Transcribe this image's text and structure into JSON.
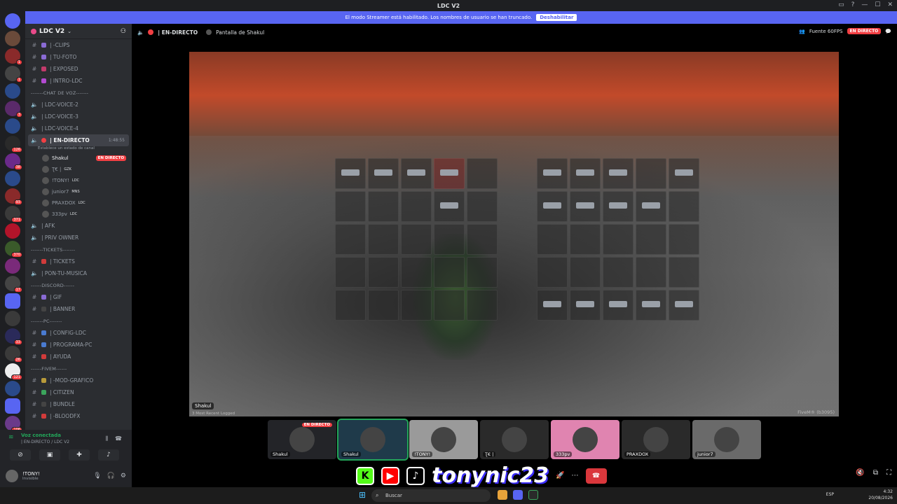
{
  "window": {
    "title": "LDC V2"
  },
  "banner": {
    "text": "El modo Streamer está habilitado. Los nombres de usuario se han truncado.",
    "button": "Deshabilitar"
  },
  "server": {
    "name": "LDC V2"
  },
  "channels": [
    {
      "type": "text",
      "label": "| -CLIPS",
      "emo": "#8a6bd4"
    },
    {
      "type": "text",
      "label": "| TU-FOTO",
      "emo": "#8a6bd4"
    },
    {
      "type": "text",
      "label": "| EXPOSED",
      "emo": "#c23a6b"
    },
    {
      "type": "text",
      "label": "| INTRO-LDC",
      "emo": "#b34bd1"
    },
    {
      "type": "cat",
      "label": "-------CHAT DE VOZ-------"
    },
    {
      "type": "voice",
      "label": "| LDC-VOICE-2"
    },
    {
      "type": "voice",
      "label": "| LDC-VOICE-3"
    },
    {
      "type": "voice",
      "label": "| LDC-VOICE-4"
    }
  ],
  "active_channel": {
    "label": "| EN-DIRECTO",
    "time": "1:48:55",
    "status": "Establece un estado de canal"
  },
  "voice_users": [
    {
      "name": "Shakul",
      "live": "EN DIRECTO"
    },
    {
      "name": "Ʈ€ |",
      "tag": "GZK"
    },
    {
      "name": "!TONY!",
      "tag": "LDC"
    },
    {
      "name": "junior7",
      "tag": "MNS"
    },
    {
      "name": "PRAXDOX",
      "tag": "LDC"
    },
    {
      "name": "333pv",
      "tag": "LDC"
    }
  ],
  "channels2": [
    {
      "type": "voice",
      "label": "| AFK"
    },
    {
      "type": "voice",
      "label": "| PRIV OWNER"
    },
    {
      "type": "cat",
      "label": "-------TICKETS-------"
    },
    {
      "type": "text",
      "label": "| TICKETS",
      "emo": "#d13b3b"
    },
    {
      "type": "voice",
      "label": "| PON-TU-MUSICA"
    },
    {
      "type": "cat",
      "label": "------DISCORD------"
    },
    {
      "type": "text",
      "label": "| GIF",
      "emo": "#8a6bd4"
    },
    {
      "type": "text",
      "label": "| BANNER",
      "emo": "#444"
    },
    {
      "type": "cat",
      "label": "-------PC-------"
    },
    {
      "type": "text",
      "label": "| CONFIG-LDC",
      "emo": "#4a7bd1"
    },
    {
      "type": "text",
      "label": "| PROGRAMA-PC",
      "emo": "#4a7bd1"
    },
    {
      "type": "text",
      "label": "| AYUDA",
      "emo": "#d13b3b"
    },
    {
      "type": "cat",
      "label": "------FIVEM------"
    },
    {
      "type": "text",
      "label": "| -MOD-GRAFICO",
      "emo": "#b89a3a"
    },
    {
      "type": "text",
      "label": "| CITIZEN",
      "emo": "#3ba55c"
    },
    {
      "type": "text",
      "label": "| BUNDLE",
      "emo": "#444"
    },
    {
      "type": "text",
      "label": "| -BLOODFX",
      "emo": "#d13b3b"
    }
  ],
  "voice_status": {
    "title": "Voz conectada",
    "channel": "| EN-DIRECTO / LDC V2"
  },
  "me": {
    "name": "!TONY!",
    "status": "Invisible"
  },
  "stage": {
    "channel": "| EN-DIRECTO",
    "screen_label": "Pantalla de Shakul",
    "quality": "Fuente 60FPS",
    "live": "EN DIRECTO",
    "game_user": "Shakul",
    "game_sub": "3 Most Recent Logged",
    "fivem": "FiveM® (b3095)"
  },
  "tiles": [
    {
      "name": "Shakul",
      "live": "EN DIRECTO",
      "color": "#232428"
    },
    {
      "name": "Shakul",
      "color": "#1f3a4a"
    },
    {
      "name": "!TONY!",
      "color": "#9a9a9a"
    },
    {
      "name": "Ʈ€ |",
      "color": "#2a2a2a"
    },
    {
      "name": "333pv",
      "color": "#e084b0"
    },
    {
      "name": "PRAXDOX",
      "color": "#2a2a2a"
    },
    {
      "name": "junior7",
      "color": "#6a6a6a"
    }
  ],
  "overlay": {
    "brand": "tonynic23"
  },
  "taskbar": {
    "search": "Buscar",
    "lang": "ESP",
    "time": "4:32",
    "date": "20/08/2026"
  }
}
